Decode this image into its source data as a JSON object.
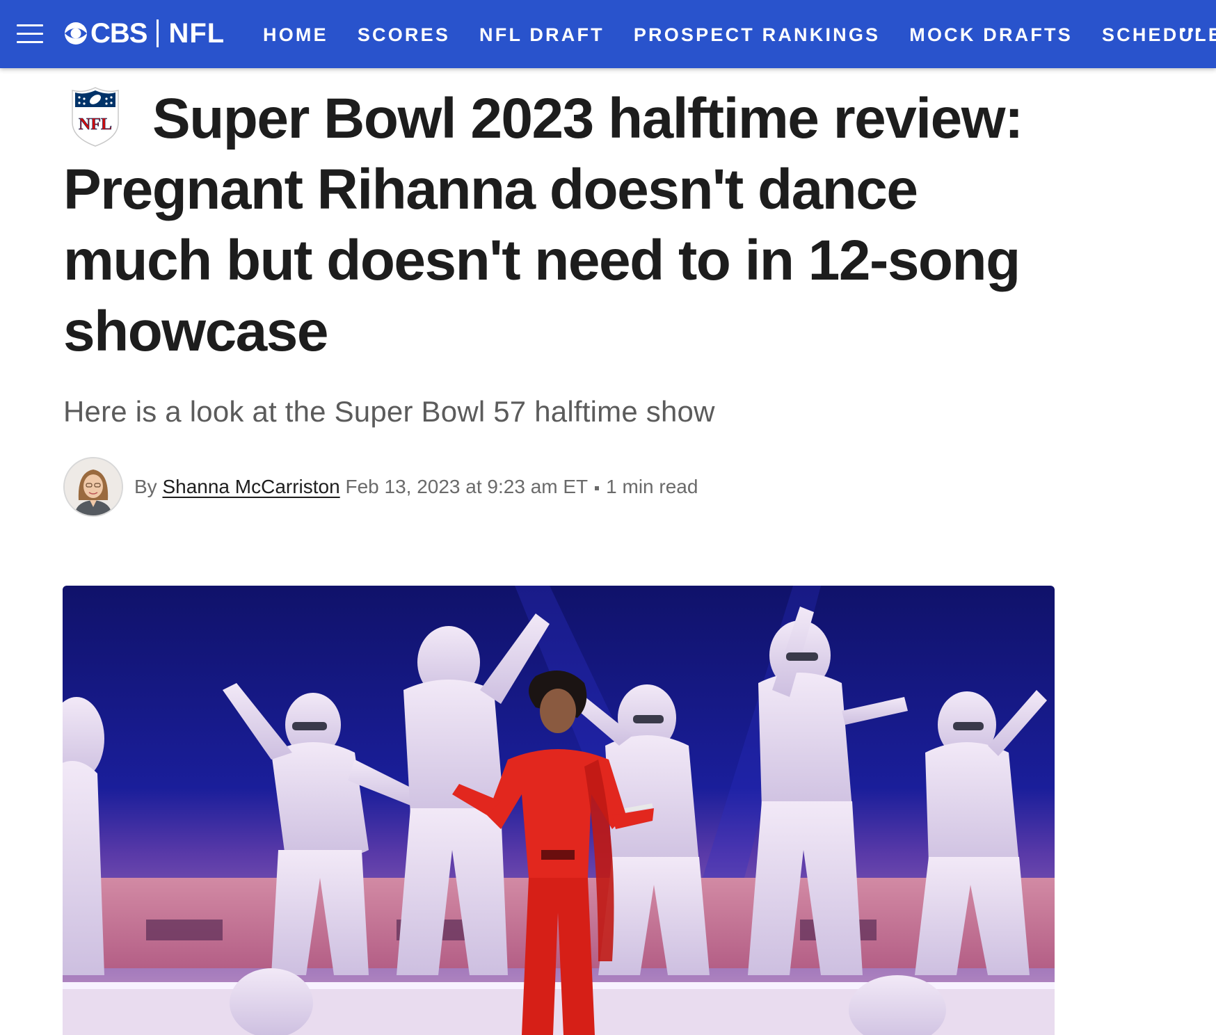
{
  "nav": {
    "brand_cbs": "CBS",
    "brand_nfl": "NFL",
    "links": [
      "HOME",
      "SCORES",
      "NFL DRAFT",
      "PROSPECT RANKINGS",
      "MOCK DRAFTS",
      "SCHEDULE"
    ],
    "icons": {
      "menu": "hamburger-menu-icon",
      "more": "more-dots-icon",
      "logo": "cbs-eye-icon"
    }
  },
  "article": {
    "league_logo": "nfl-shield-icon",
    "league_logo_text": "NFL",
    "headline": "Super Bowl 2023 halftime review: Pregnant Rihanna doesn't dance much but doesn't need to in 12-song showcase",
    "subheadline": "Here is a look at the Super Bowl 57 halftime show",
    "byline": {
      "prefix": "By",
      "author": "Shanna McCarriston",
      "date": "Feb 13, 2023 at 9:23 am ET",
      "read_time": "1 min read"
    }
  },
  "colors": {
    "nav_bg": "#2953cc",
    "headline": "#1d1d1d",
    "nfl_red": "#d50a0a",
    "nfl_navy": "#013369"
  }
}
